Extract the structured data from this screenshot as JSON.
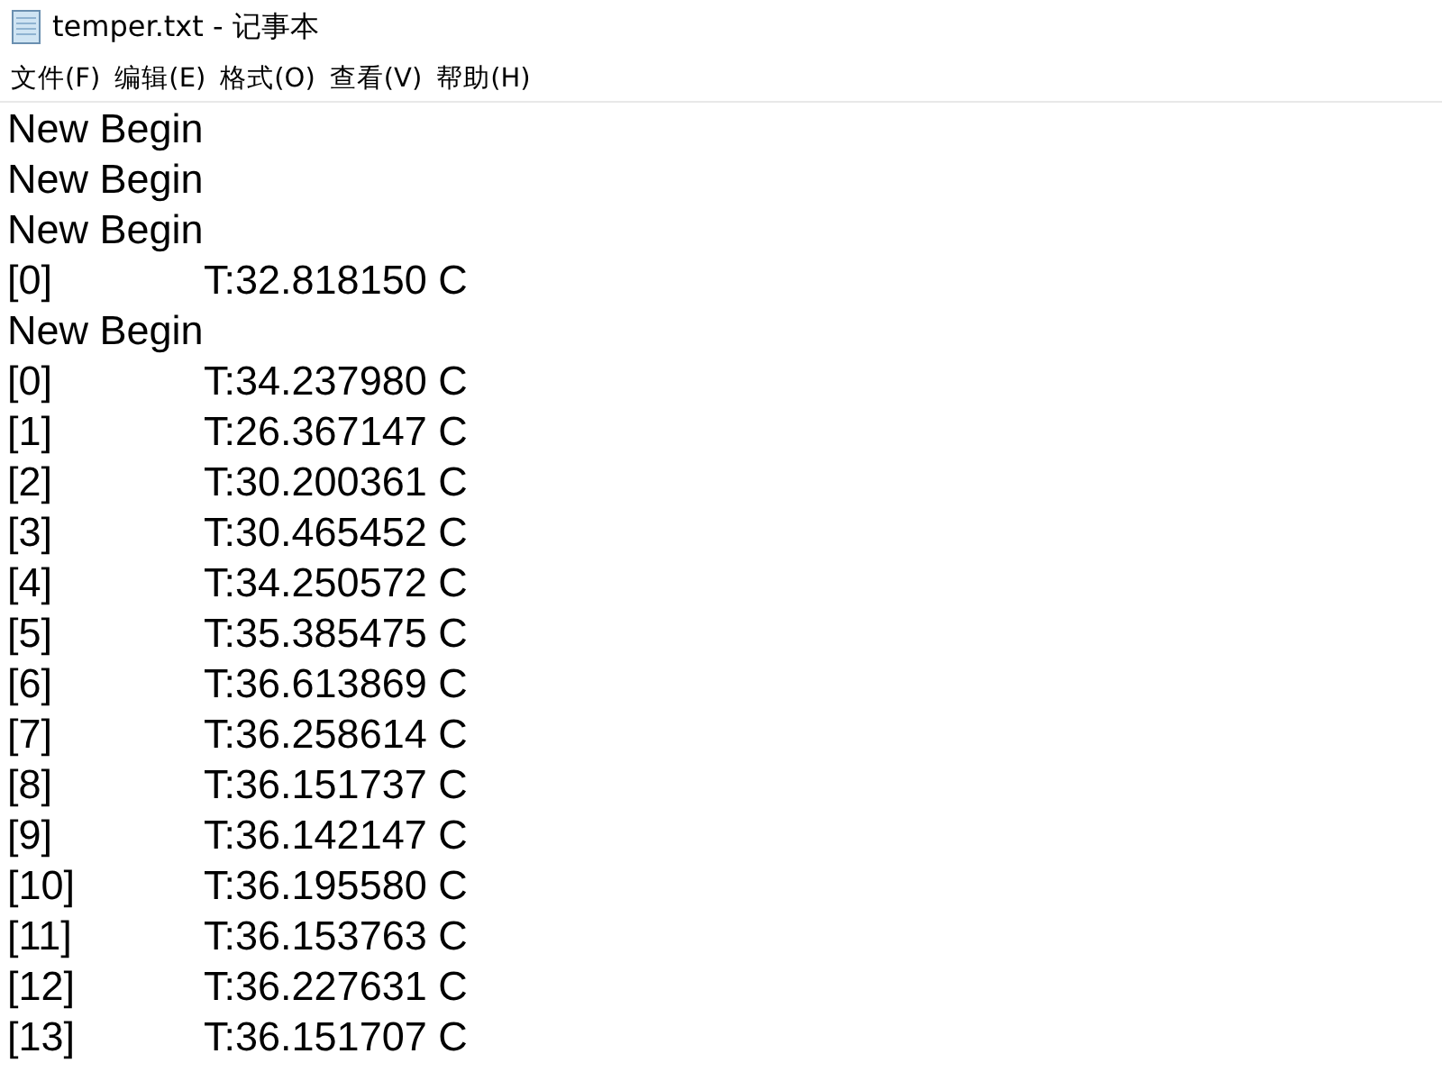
{
  "window": {
    "title": "temper.txt - 记事本"
  },
  "menu": [
    "文件(F)",
    "编辑(E)",
    "格式(O)",
    "查看(V)",
    "帮助(H)"
  ],
  "lines": [
    {
      "kind": "text",
      "text": "New Begin"
    },
    {
      "kind": "text",
      "text": "New Begin"
    },
    {
      "kind": "text",
      "text": "New Begin"
    },
    {
      "kind": "entry",
      "index": "[0]",
      "value": "T:32.818150 C"
    },
    {
      "kind": "text",
      "text": "New Begin"
    },
    {
      "kind": "entry",
      "index": "[0]",
      "value": "T:34.237980 C"
    },
    {
      "kind": "entry",
      "index": "[1]",
      "value": "T:26.367147 C"
    },
    {
      "kind": "entry",
      "index": "[2]",
      "value": "T:30.200361 C"
    },
    {
      "kind": "entry",
      "index": "[3]",
      "value": "T:30.465452 C"
    },
    {
      "kind": "entry",
      "index": "[4]",
      "value": "T:34.250572 C"
    },
    {
      "kind": "entry",
      "index": "[5]",
      "value": "T:35.385475 C"
    },
    {
      "kind": "entry",
      "index": "[6]",
      "value": "T:36.613869 C"
    },
    {
      "kind": "entry",
      "index": "[7]",
      "value": "T:36.258614 C"
    },
    {
      "kind": "entry",
      "index": "[8]",
      "value": "T:36.151737 C"
    },
    {
      "kind": "entry",
      "index": "[9]",
      "value": "T:36.142147 C"
    },
    {
      "kind": "entry",
      "index": "[10]",
      "value": "T:36.195580 C"
    },
    {
      "kind": "entry",
      "index": "[11]",
      "value": "T:36.153763 C"
    },
    {
      "kind": "entry",
      "index": "[12]",
      "value": "T:36.227631 C"
    },
    {
      "kind": "entry",
      "index": "[13]",
      "value": "T:36.151707 C"
    }
  ]
}
